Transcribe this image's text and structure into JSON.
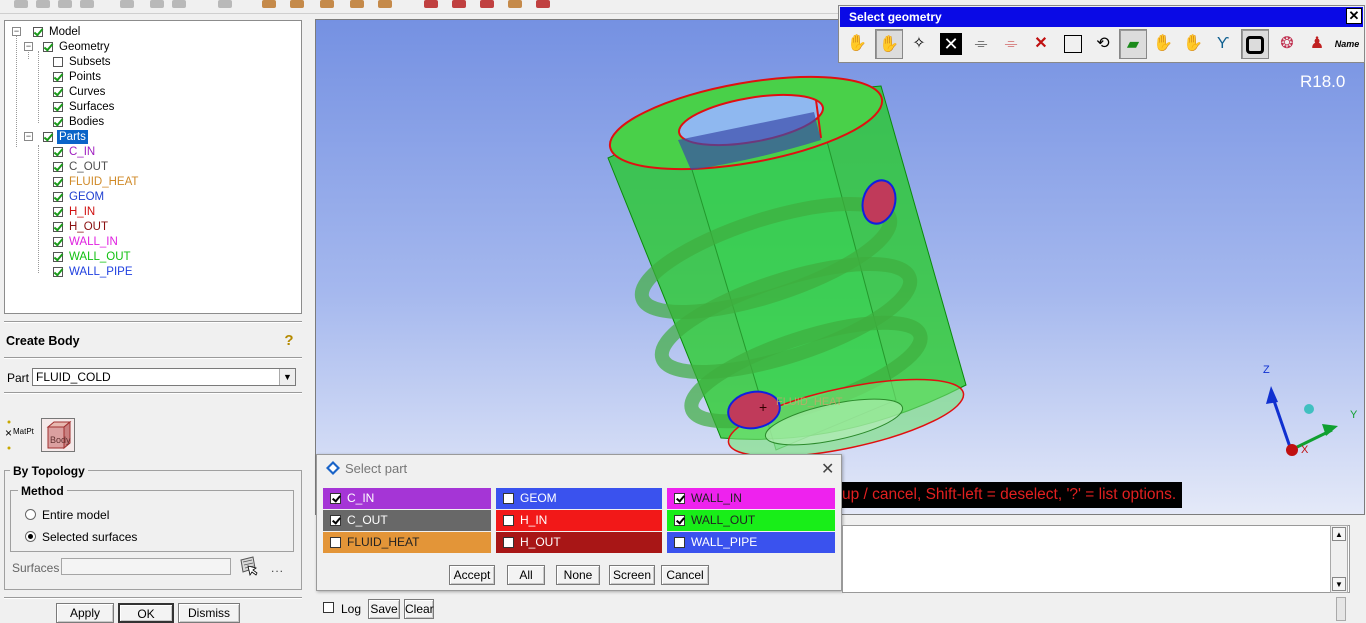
{
  "tree": {
    "model": "Model",
    "geometry": "Geometry",
    "geometry_children": [
      "Subsets",
      "Points",
      "Curves",
      "Surfaces",
      "Bodies"
    ],
    "parts": "Parts",
    "part_items": [
      {
        "label": "C_IN",
        "color": "#a020c0"
      },
      {
        "label": "C_OUT",
        "color": "#505050"
      },
      {
        "label": "FLUID_HEAT",
        "color": "#d08a28"
      },
      {
        "label": "GEOM",
        "color": "#2040d0"
      },
      {
        "label": "H_IN",
        "color": "#d01010"
      },
      {
        "label": "H_OUT",
        "color": "#8a1010"
      },
      {
        "label": "WALL_IN",
        "color": "#e020e0"
      },
      {
        "label": "WALL_OUT",
        "color": "#10c010"
      },
      {
        "label": "WALL_PIPE",
        "color": "#2040e0"
      }
    ]
  },
  "create_body": {
    "title": "Create Body",
    "part_label": "Part",
    "part_value": "FLUID_COLD",
    "matpt_label": "MatPt",
    "body_label": "Body",
    "by_topology": "By Topology",
    "method": "Method",
    "entire_model": "Entire model",
    "selected_surfaces": "Selected surfaces",
    "surfaces_label": "Surfaces",
    "more": "...",
    "apply": "Apply",
    "ok": "OK",
    "dismiss": "Dismiss"
  },
  "viewport": {
    "version": "R18.0",
    "status": "up / cancel, Shift-left = deselect, '?' = list options.",
    "label_fluid_heat": "FLUID_HEAT",
    "axis_x": "X",
    "axis_y": "Y",
    "axis_z": "Z"
  },
  "select_geometry": {
    "title": "Select geometry",
    "name_label": "Name"
  },
  "select_part": {
    "title": "Select part",
    "cells": [
      {
        "label": "C_IN",
        "checked": true,
        "bg": "#a535d6",
        "fg": "#fff"
      },
      {
        "label": "GEOM",
        "checked": false,
        "bg": "#3a52ee",
        "fg": "#fff"
      },
      {
        "label": "WALL_IN",
        "checked": true,
        "bg": "#ee22ee",
        "fg": "#222"
      },
      {
        "label": "C_OUT",
        "checked": true,
        "bg": "#686868",
        "fg": "#fff"
      },
      {
        "label": "H_IN",
        "checked": false,
        "bg": "#f21818",
        "fg": "#fff"
      },
      {
        "label": "WALL_OUT",
        "checked": true,
        "bg": "#18ee18",
        "fg": "#222"
      },
      {
        "label": "FLUID_HEAT",
        "checked": false,
        "bg": "#e39538",
        "fg": "#222"
      },
      {
        "label": "H_OUT",
        "checked": false,
        "bg": "#a81616",
        "fg": "#fff"
      },
      {
        "label": "WALL_PIPE",
        "checked": false,
        "bg": "#3a52ee",
        "fg": "#fff"
      }
    ],
    "accept": "Accept",
    "all": "All",
    "none": "None",
    "screen": "Screen",
    "cancel": "Cancel"
  },
  "output": {
    "log": "Log",
    "save": "Save",
    "clear": "Clear"
  }
}
